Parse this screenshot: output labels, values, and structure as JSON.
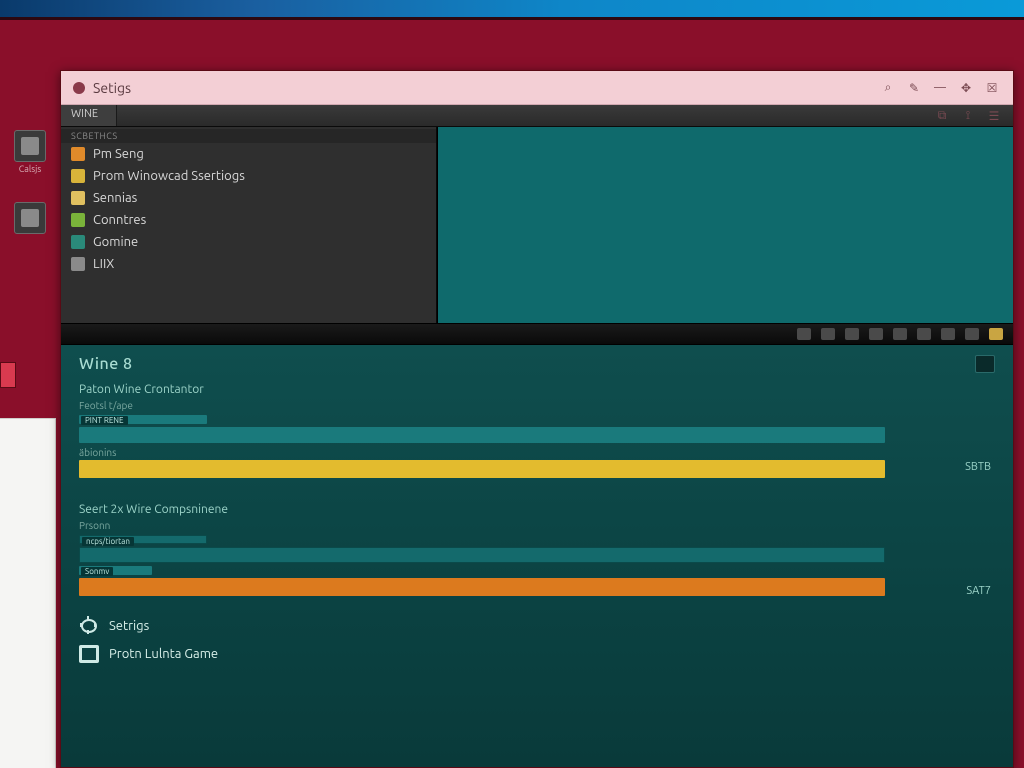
{
  "desktop": {
    "icon_label": "Calsjs"
  },
  "titlebar": {
    "title": "Setigs",
    "icons": {
      "search": "⌕",
      "edit": "✎",
      "minimize": "—",
      "pin": "✥",
      "close": "☒"
    }
  },
  "tabs": {
    "tab0": "WINE",
    "right_icons": [
      "⧉",
      "⟟",
      "☰"
    ]
  },
  "sidebar": {
    "section": "SCBETHCS",
    "items": [
      {
        "label": "Pm Seng"
      },
      {
        "label": "Prom Winowcad Ssertiogs"
      },
      {
        "label": "Sennias"
      },
      {
        "label": "Conntres"
      },
      {
        "label": "Gomine"
      },
      {
        "label": "LIIX"
      }
    ]
  },
  "lower": {
    "title": "Wine 8",
    "group1": {
      "heading": "Paton Wine Crontantor",
      "sub1": "Feotsl t/ape",
      "chip1": "PINT RENE",
      "sub2": "äbionins",
      "right_label": "SBTB"
    },
    "group2": {
      "heading": "Seert 2x Wire Compsninene",
      "sub1": "Prsonn",
      "chip1": "ncps/tiortan",
      "chip2": "Sonmv",
      "right_label": "SAT7"
    },
    "bottom": {
      "settings": "Setrigs",
      "game": "Protn Lulnta Game"
    }
  }
}
